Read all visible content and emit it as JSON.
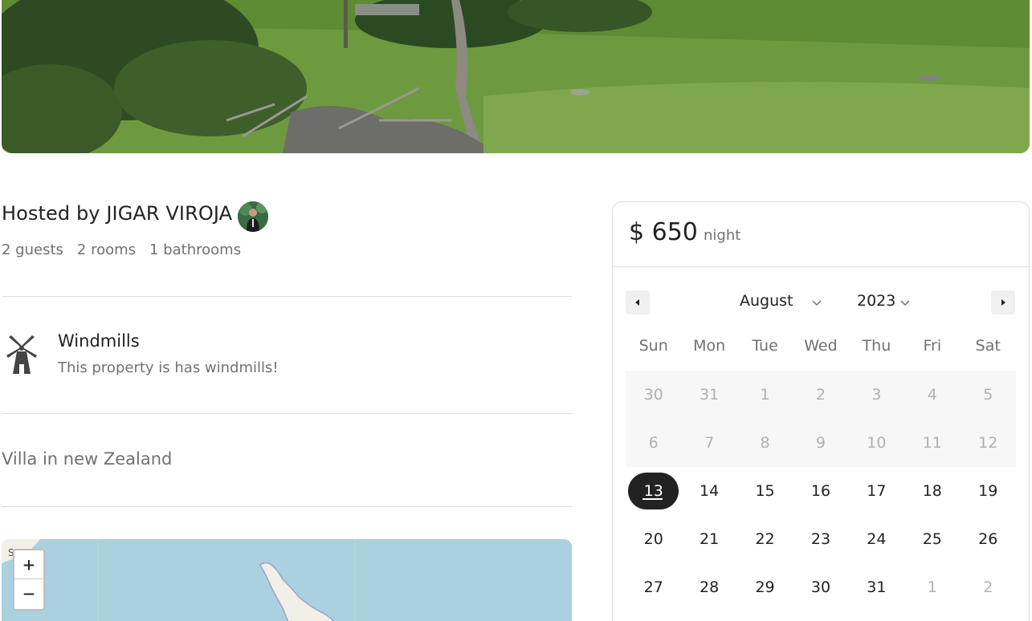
{
  "host": {
    "title": "Hosted by JIGAR VIROJA"
  },
  "stats": {
    "guests": "2 guests",
    "rooms": "2 rooms",
    "bathrooms": "1 bathrooms"
  },
  "feature": {
    "icon": "windmill-icon",
    "title": "Windmills",
    "description": "This property is has windmills!"
  },
  "description": "Villa in new Zealand",
  "map": {
    "zoom_in": "+",
    "zoom_out": "−",
    "label": "S"
  },
  "booking": {
    "price": "$ 650",
    "per_unit": "night",
    "month": "August",
    "year": "2023",
    "weekdays": [
      "Sun",
      "Mon",
      "Tue",
      "Wed",
      "Thu",
      "Fri",
      "Sat"
    ],
    "weeks": [
      [
        "30",
        "31",
        "1",
        "2",
        "3",
        "4",
        "5"
      ],
      [
        "6",
        "7",
        "8",
        "9",
        "10",
        "11",
        "12"
      ],
      [
        "13",
        "14",
        "15",
        "16",
        "17",
        "18",
        "19"
      ],
      [
        "20",
        "21",
        "22",
        "23",
        "24",
        "25",
        "26"
      ],
      [
        "27",
        "28",
        "29",
        "30",
        "31",
        "1",
        "2"
      ]
    ],
    "selected_day": "13"
  },
  "colors": {
    "selected_bg": "#222222",
    "muted_text": "#717171",
    "disabled_text": "#b0b0b0"
  }
}
